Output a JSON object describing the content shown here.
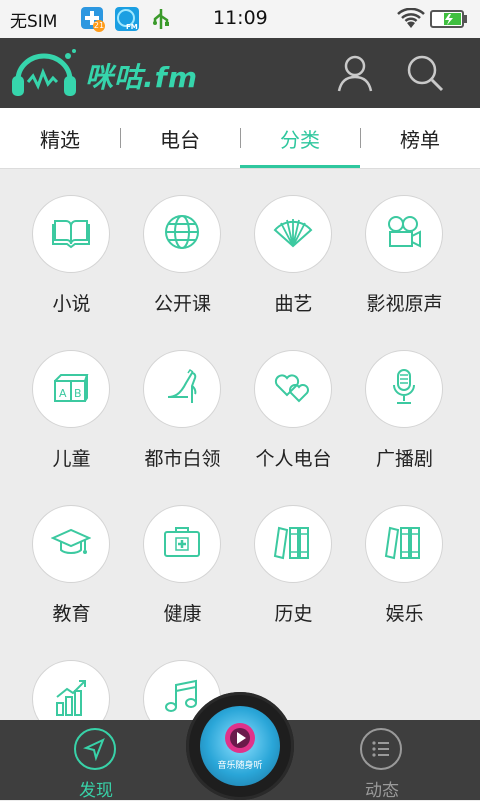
{
  "status_bar": {
    "carrier": "无SIM",
    "time": "11:09",
    "notif_badge": "21",
    "fm_badge": "FM",
    "icons": [
      "plus-badge-icon",
      "fm-app-icon",
      "usb-icon",
      "wifi-icon",
      "battery-charging-icon"
    ]
  },
  "header": {
    "logo_text": "咪咕.fm",
    "icons": [
      "headphone-logo-icon",
      "user-icon",
      "search-icon"
    ]
  },
  "tabs": [
    {
      "label": "精选"
    },
    {
      "label": "电台"
    },
    {
      "label": "分类"
    },
    {
      "label": "榜单"
    }
  ],
  "active_tab": "分类",
  "categories": [
    {
      "label": "小说",
      "icon": "book-icon"
    },
    {
      "label": "公开课",
      "icon": "globe-icon"
    },
    {
      "label": "曲艺",
      "icon": "fan-icon"
    },
    {
      "label": "影视原声",
      "icon": "film-camera-icon"
    },
    {
      "label": "儿童",
      "icon": "abc-blocks-icon"
    },
    {
      "label": "都市白领",
      "icon": "high-heel-icon"
    },
    {
      "label": "个人电台",
      "icon": "hearts-icon"
    },
    {
      "label": "广播剧",
      "icon": "microphone-icon"
    },
    {
      "label": "教育",
      "icon": "graduation-cap-icon"
    },
    {
      "label": "健康",
      "icon": "first-aid-kit-icon"
    },
    {
      "label": "历史",
      "icon": "books-icon"
    },
    {
      "label": "娱乐",
      "icon": "books-icon"
    },
    {
      "label": "",
      "icon": "bar-chart-icon"
    },
    {
      "label": "",
      "icon": "music-note-icon"
    }
  ],
  "bottom_nav": {
    "discover_label": "发现",
    "feed_label": "动态",
    "player_caption": "音乐随身听"
  },
  "colors": {
    "accent": "#2fc79e",
    "header_bg": "#3d3d3d",
    "nav_bg": "#3e3e3e",
    "page_bg": "#ececec"
  }
}
